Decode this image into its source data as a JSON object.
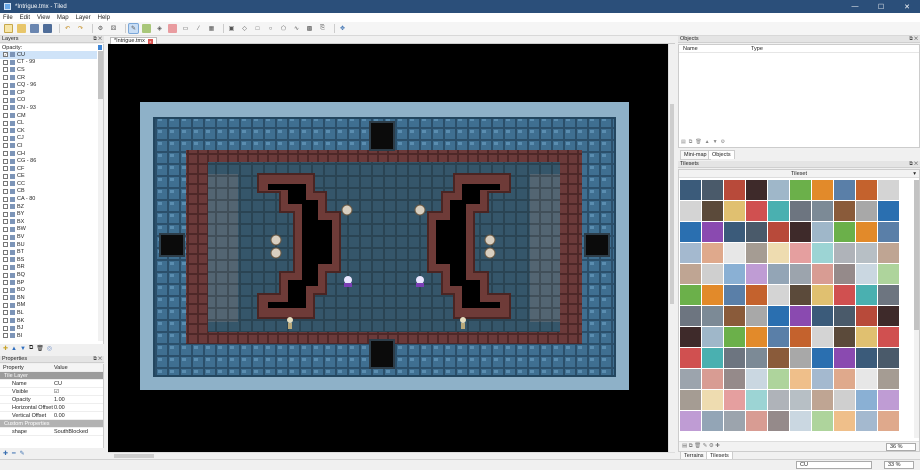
{
  "window": {
    "title": "*Intrigue.tmx - Tiled",
    "minimize": "—",
    "maximize": "☐",
    "close": "✕"
  },
  "menu": [
    "File",
    "Edit",
    "View",
    "Map",
    "Layer",
    "Help"
  ],
  "toolbar_icons": [
    "new-icon",
    "open-icon",
    "save-icon",
    "save-all-icon",
    "undo-icon",
    "redo-icon",
    "commands-icon",
    "stamp-brush-icon",
    "terrain-brush-icon",
    "bucket-fill-icon",
    "eraser-icon",
    "rect-select-icon",
    "magic-wand-icon",
    "select-same-icon",
    "object-select-icon",
    "edit-polygon-icon",
    "insert-rect-icon",
    "insert-ellipse-icon",
    "insert-polygon-icon",
    "insert-polyline-icon",
    "insert-tile-icon",
    "insert-text-icon",
    "random-mode-icon"
  ],
  "document_tab": {
    "label": "*Intrigue.tmx",
    "close": "x"
  },
  "layers_panel": {
    "title": "Layers",
    "opacity_label": "Opacity:",
    "items": [
      "CU",
      "CT - 99",
      "CS",
      "CR",
      "CQ - 96",
      "CP",
      "CO",
      "CN - 93",
      "CM",
      "CL",
      "CK",
      "CJ",
      "CI",
      "CH",
      "CG - 86",
      "CF",
      "CE",
      "CC",
      "CB",
      "CA - 80",
      "BZ",
      "BY",
      "BX",
      "BW",
      "BV",
      "BU",
      "BT",
      "BS",
      "BR",
      "BQ",
      "BP",
      "BO",
      "BN",
      "BM",
      "BL",
      "BK",
      "BJ",
      "BI"
    ]
  },
  "properties_panel": {
    "title": "Properties",
    "col_property": "Property",
    "col_value": "Value",
    "group_tile": "Tile Layer",
    "rows": [
      {
        "k": "Name",
        "v": "CU"
      },
      {
        "k": "Visible",
        "v": "☑"
      },
      {
        "k": "Opacity",
        "v": "1.00"
      },
      {
        "k": "Horizontal Offset",
        "v": "0.00"
      },
      {
        "k": "Vertical Offset",
        "v": "0.00"
      }
    ],
    "group_custom": "Custom Properties",
    "custom_rows": [
      {
        "k": "shape",
        "v": "SouthBlocked"
      }
    ]
  },
  "objects_panel": {
    "title": "Objects",
    "col_name": "Name",
    "col_type": "Type",
    "tab_minimap": "Mini-map",
    "tab_objects": "Objects"
  },
  "tilesets_panel": {
    "title": "Tilesets",
    "current": "Tileset",
    "zoom": "36 %",
    "tab_terrains": "Terrains",
    "tab_tilesets": "Tilesets"
  },
  "status": {
    "layer": "CU",
    "zoom": "33 %"
  },
  "colors": {
    "titlebar": "#2b4f7a",
    "map_frame": "#8eb1c8",
    "wall_blue": "#3f6f91",
    "floor": "#35566a",
    "brick": "#6b3a3a"
  }
}
